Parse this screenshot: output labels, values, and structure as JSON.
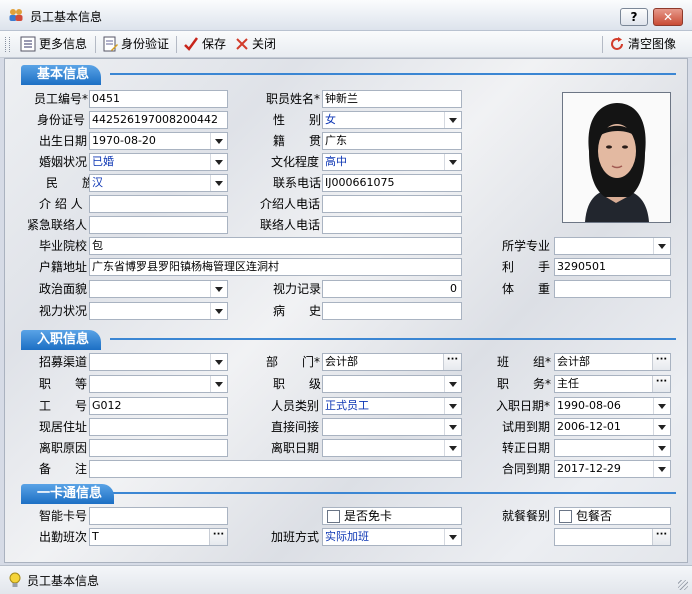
{
  "window": {
    "title": "员工基本信息",
    "help_btn": "?",
    "close_btn": "✕"
  },
  "toolbar": {
    "more_info": "更多信息",
    "id_verify": "身份验证",
    "save": "保存",
    "close": "关闭",
    "clear_image": "清空图像"
  },
  "sections": {
    "basic": "基本信息",
    "entry": "入职信息",
    "card": "一卡通信息"
  },
  "basic": {
    "emp_no": {
      "label": "员工编号*",
      "value": "0451"
    },
    "name": {
      "label": "职员姓名*",
      "value": "钟新兰"
    },
    "id_no": {
      "label": "身份证号",
      "value": "442526197008200442"
    },
    "gender": {
      "label": "性　　别",
      "value": "女"
    },
    "birth": {
      "label": "出生日期",
      "value": "1970-08-20"
    },
    "native": {
      "label": "籍　　贯",
      "value": "广东"
    },
    "marital": {
      "label": "婚姻状况",
      "value": "已婚"
    },
    "education": {
      "label": "文化程度",
      "value": "高中"
    },
    "ethnic": {
      "label": "民　　族",
      "value": "汉"
    },
    "phone": {
      "label": "联系电话",
      "value": "IJ000661075"
    },
    "introducer": {
      "label": "介 绍 人",
      "value": ""
    },
    "introducer_phone": {
      "label": "介绍人电话",
      "value": ""
    },
    "emergency": {
      "label": "紧急联络人",
      "value": ""
    },
    "emergency_phone": {
      "label": "联络人电话",
      "value": ""
    },
    "school": {
      "label": "毕业院校",
      "value": "包"
    },
    "major": {
      "label": "所学专业",
      "value": ""
    },
    "hukou": {
      "label": "户籍地址",
      "value": "广东省博罗县罗阳镇杨梅管理区连洞村"
    },
    "hand": {
      "label": "利　　手",
      "value": "3290501"
    },
    "political": {
      "label": "政治面貌",
      "value": ""
    },
    "vision_record": {
      "label": "视力记录",
      "value": "0"
    },
    "weight": {
      "label": "体　　重",
      "value": ""
    },
    "vision_status": {
      "label": "视力状况",
      "value": ""
    },
    "medical": {
      "label": "病　　史",
      "value": ""
    }
  },
  "entry": {
    "channel": {
      "label": "招募渠道",
      "value": ""
    },
    "dept": {
      "label": "部　　门*",
      "value": "会计部"
    },
    "team": {
      "label": "班　　组*",
      "value": "会计部"
    },
    "grade": {
      "label": "职　　等",
      "value": ""
    },
    "level": {
      "label": "职　　级",
      "value": ""
    },
    "position": {
      "label": "职　　务*",
      "value": "主任"
    },
    "work_no": {
      "label": "工　　号",
      "value": "G012"
    },
    "staff_type": {
      "label": "人员类别",
      "value": "正式员工"
    },
    "join_date": {
      "label": "入职日期*",
      "value": "1990-08-06"
    },
    "address": {
      "label": "现居住址",
      "value": ""
    },
    "direct": {
      "label": "直接间接",
      "value": ""
    },
    "probation_end": {
      "label": "试用到期",
      "value": "2006-12-01"
    },
    "leave_reason": {
      "label": "离职原因",
      "value": ""
    },
    "leave_date": {
      "label": "离职日期",
      "value": ""
    },
    "regular_date": {
      "label": "转正日期",
      "value": ""
    },
    "remark": {
      "label": "备　　注",
      "value": ""
    },
    "contract_end": {
      "label": "合同到期",
      "value": "2017-12-29"
    }
  },
  "card": {
    "card_no": {
      "label": "智能卡号",
      "value": ""
    },
    "exempt": {
      "label": "是否免卡",
      "checked": false
    },
    "meal_type": {
      "label": "就餐餐别",
      "value": ""
    },
    "meal_inclusive": {
      "label": "包餐否",
      "checked": false
    },
    "shift": {
      "label": "出勤班次",
      "value": "T"
    },
    "overtime": {
      "label": "加班方式",
      "value": "实际加班"
    },
    "extra": {
      "value": ""
    }
  },
  "status": {
    "text": "员工基本信息"
  }
}
